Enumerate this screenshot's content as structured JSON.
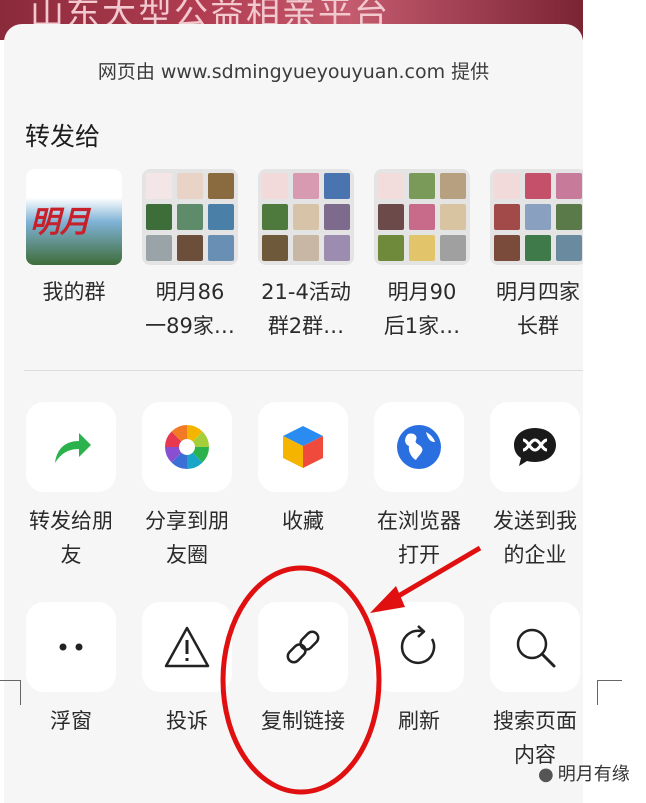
{
  "background": {
    "title": "山东大型公益相亲平台"
  },
  "sheet": {
    "provider": "网页由 www.sdmingyueyouyuan.com 提供",
    "section_title": "转发给"
  },
  "contacts": [
    {
      "name": "我的群"
    },
    {
      "name": "明月86\n一89家…"
    },
    {
      "name": "21-4活动\n群2群…"
    },
    {
      "name": "明月90\n后1家…"
    },
    {
      "name": "明月四家\n长群"
    }
  ],
  "actions_row1": [
    {
      "label": "转发给朋\n友",
      "icon": "forward-arrow-icon"
    },
    {
      "label": "分享到朋\n友圈",
      "icon": "moments-aperture-icon"
    },
    {
      "label": "收藏",
      "icon": "favorite-cube-icon"
    },
    {
      "label": "在浏览器\n打开",
      "icon": "globe-icon"
    },
    {
      "label": "发送到我\n的企业",
      "icon": "wework-icon"
    }
  ],
  "actions_row2": [
    {
      "label": "浮窗",
      "icon": "float-window-icon"
    },
    {
      "label": "投诉",
      "icon": "warning-icon"
    },
    {
      "label": "复制链接",
      "icon": "link-icon"
    },
    {
      "label": "刷新",
      "icon": "refresh-icon"
    },
    {
      "label": "搜索页面\n内容",
      "icon": "search-icon"
    }
  ],
  "watermark": "明月有缘",
  "annotation": {
    "color": "#e01010"
  }
}
